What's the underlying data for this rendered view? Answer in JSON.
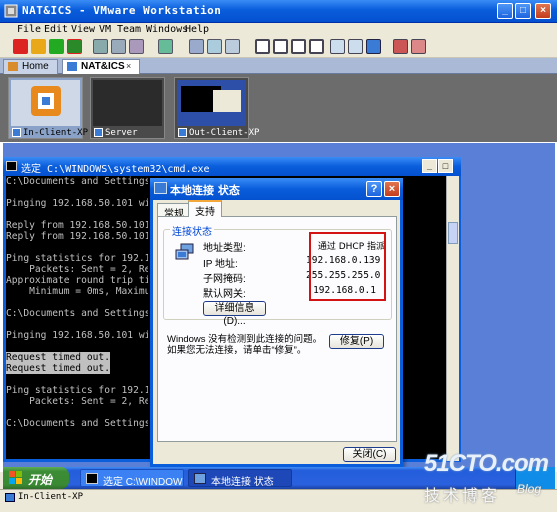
{
  "app": {
    "title": "NAT&ICS - VMware Workstation",
    "menu": [
      "File",
      "Edit",
      "View",
      "VM",
      "Team",
      "Windows",
      "Help"
    ],
    "tabs": [
      {
        "label": "Home"
      },
      {
        "label": "NAT&ICS"
      }
    ],
    "thumbnails": [
      {
        "label": "In-Client-XP"
      },
      {
        "label": "Server"
      },
      {
        "label": "Out-Client-XP"
      }
    ],
    "status": "In-Client-XP"
  },
  "cmd": {
    "title": "选定 C:\\WINDOWS\\system32\\cmd.exe",
    "lines": [
      "C:\\Documents and Settings\\",
      "",
      "Pinging 192.168.50.101 wit",
      "",
      "Reply from 192.168.50.101:",
      "Reply from 192.168.50.101:",
      "",
      "Ping statistics for 192.16",
      "    Packets: Sent = 2, Rec",
      "Approximate round trip tim",
      "    Minimum = 0ms, Maximum",
      "",
      "C:\\Documents and Settings\\",
      "",
      "Pinging 192.168.50.101 wit",
      "",
      "Request timed out.",
      "Request timed out.",
      "",
      "Ping statistics for 192.16",
      "    Packets: Sent = 2, Rec",
      "",
      "C:\\Documents and Settings\\"
    ]
  },
  "dialog": {
    "title": "本地连接 状态",
    "tabs": [
      "常规",
      "支持"
    ],
    "group_label": "连接状态",
    "rows": [
      {
        "label": "地址类型:",
        "value": "通过 DHCP 指派"
      },
      {
        "label": "IP 地址:",
        "value": "192.168.0.139"
      },
      {
        "label": "子网掩码:",
        "value": "255.255.255.0"
      },
      {
        "label": "默认网关:",
        "value": "192.168.0.1"
      }
    ],
    "details_button": "详细信息(D)...",
    "message": "Windows 没有检测到此连接的问题。如果您无法连接，请单击“修复”。",
    "repair_button": "修复(P)",
    "close_button": "关闭(C)"
  },
  "taskbar": {
    "start": "开始",
    "tasks": [
      {
        "label": "选定 C:\\WINDOWS\\..."
      },
      {
        "label": "本地连接 状态"
      }
    ]
  },
  "watermark": {
    "line1": "51CTO.com",
    "line2": "技术博客",
    "line3": "Blog"
  },
  "colors": {
    "title_blue": "#0a5ddb",
    "highlight_red": "#d31313",
    "taskbar_blue": "#245edb",
    "start_green": "#3c8c36"
  }
}
